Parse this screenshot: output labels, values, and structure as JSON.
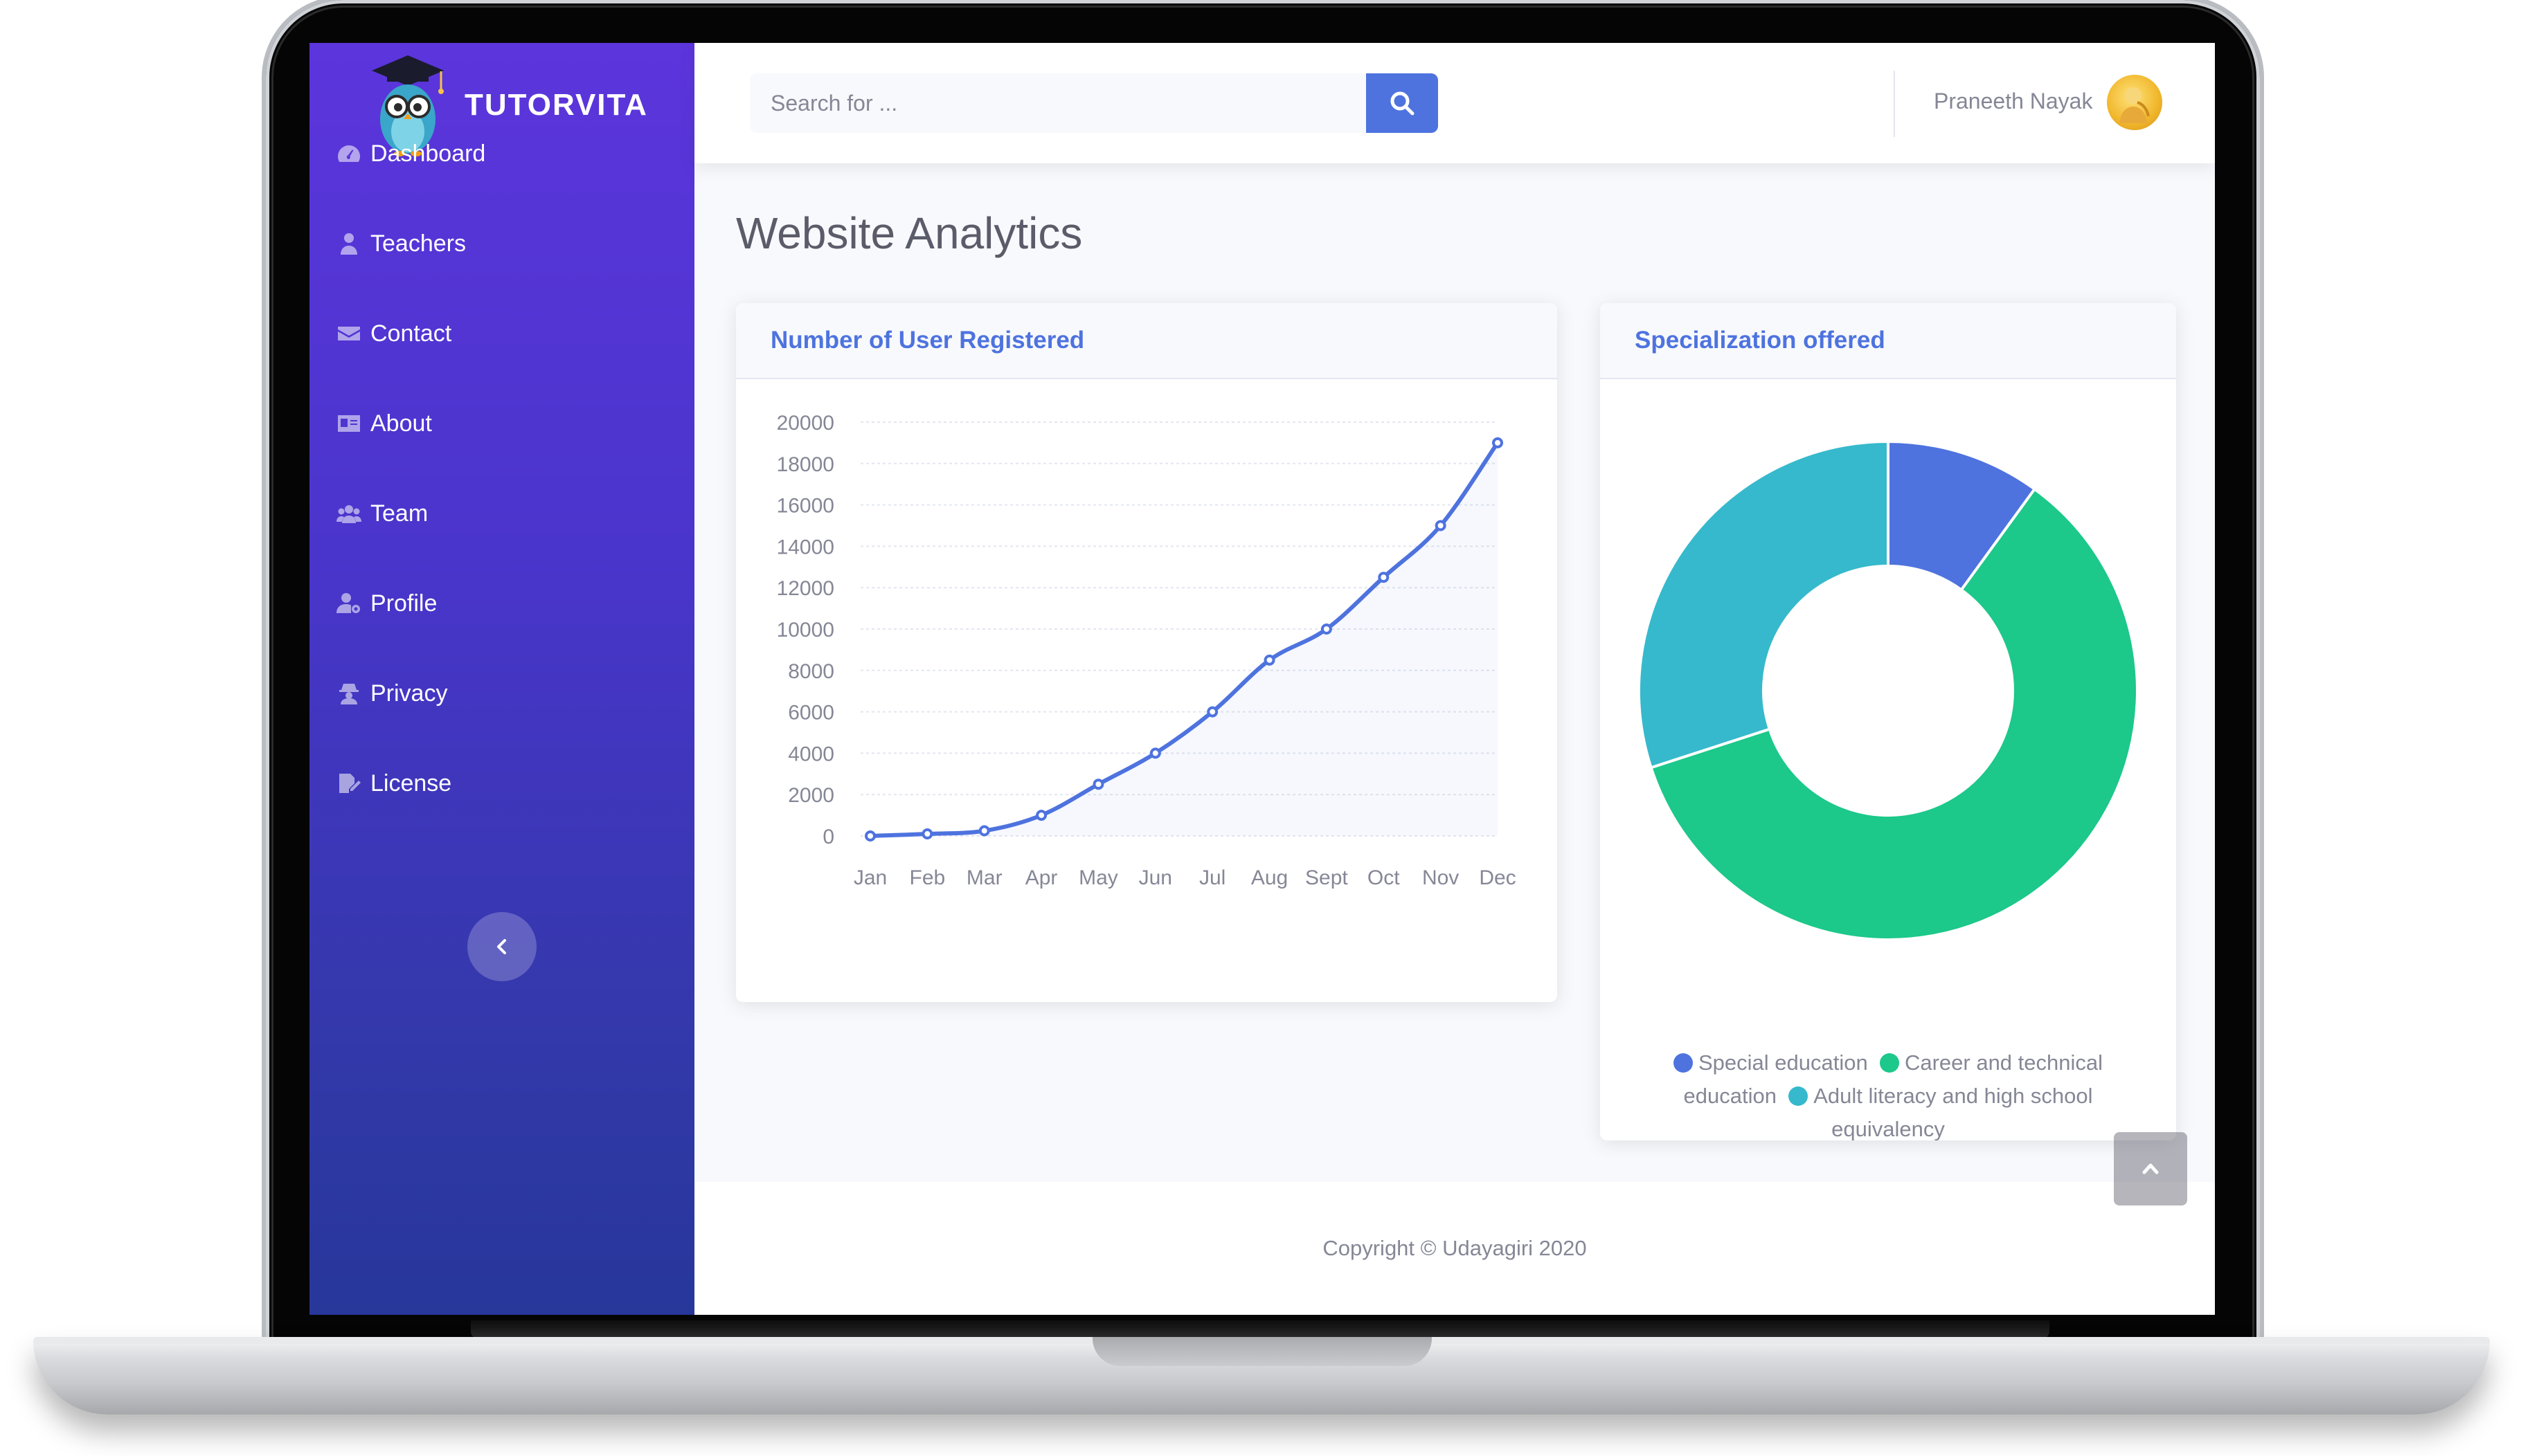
{
  "app": {
    "brand": "TUTORVITA"
  },
  "sidebar": {
    "items": [
      {
        "label": "Dashboard",
        "icon": "tachometer-icon"
      },
      {
        "label": "Teachers",
        "icon": "user-tie-icon"
      },
      {
        "label": "Contact",
        "icon": "envelope-icon"
      },
      {
        "label": "About",
        "icon": "id-card-icon"
      },
      {
        "label": "Team",
        "icon": "users-icon"
      },
      {
        "label": "Profile",
        "icon": "user-cog-icon"
      },
      {
        "label": "Privacy",
        "icon": "user-secret-icon"
      },
      {
        "label": "License",
        "icon": "file-signature-icon"
      }
    ],
    "collapse_icon": "chevron-left-icon"
  },
  "topbar": {
    "search_placeholder": "Search for ...",
    "search_icon": "search-icon",
    "user_name": "Praneeth Nayak"
  },
  "main": {
    "page_title": "Website Analytics",
    "line_card_title": "Number of User Registered",
    "donut_card_title": "Specialization offered"
  },
  "colors": {
    "primary": "#4e73df",
    "success": "#1cc88a",
    "info": "#36b9cc",
    "sidebar_top": "#5c35dc",
    "sidebar_bottom": "#27379a"
  },
  "chart_data": [
    {
      "type": "line",
      "title": "Number of User Registered",
      "x": [
        "Jan",
        "Feb",
        "Mar",
        "Apr",
        "May",
        "Jun",
        "Jul",
        "Aug",
        "Sept",
        "Oct",
        "Nov",
        "Dec"
      ],
      "series": [
        {
          "values": [
            0,
            100,
            250,
            1000,
            2500,
            4000,
            6000,
            8500,
            10000,
            12500,
            15000,
            19000
          ]
        }
      ],
      "yticks": [
        "0",
        "2000",
        "4000",
        "6000",
        "8000",
        "10000",
        "12000",
        "14000",
        "16000",
        "18000",
        "20000"
      ],
      "ylim": [
        0,
        20000
      ],
      "grid": true,
      "color": "#4e73df"
    },
    {
      "type": "pie",
      "title": "Specialization offered",
      "labels": [
        "Special education",
        "Career and technical education",
        "Adult literacy and high school equivalency"
      ],
      "values": [
        10,
        60,
        30
      ],
      "colors": [
        "#4e73df",
        "#1cc88a",
        "#36b9cc"
      ],
      "legend": "bottom"
    }
  ],
  "footer": {
    "copyright": "Copyright © Udayagiri 2020"
  },
  "scroll_top_icon": "chevron-up-icon"
}
